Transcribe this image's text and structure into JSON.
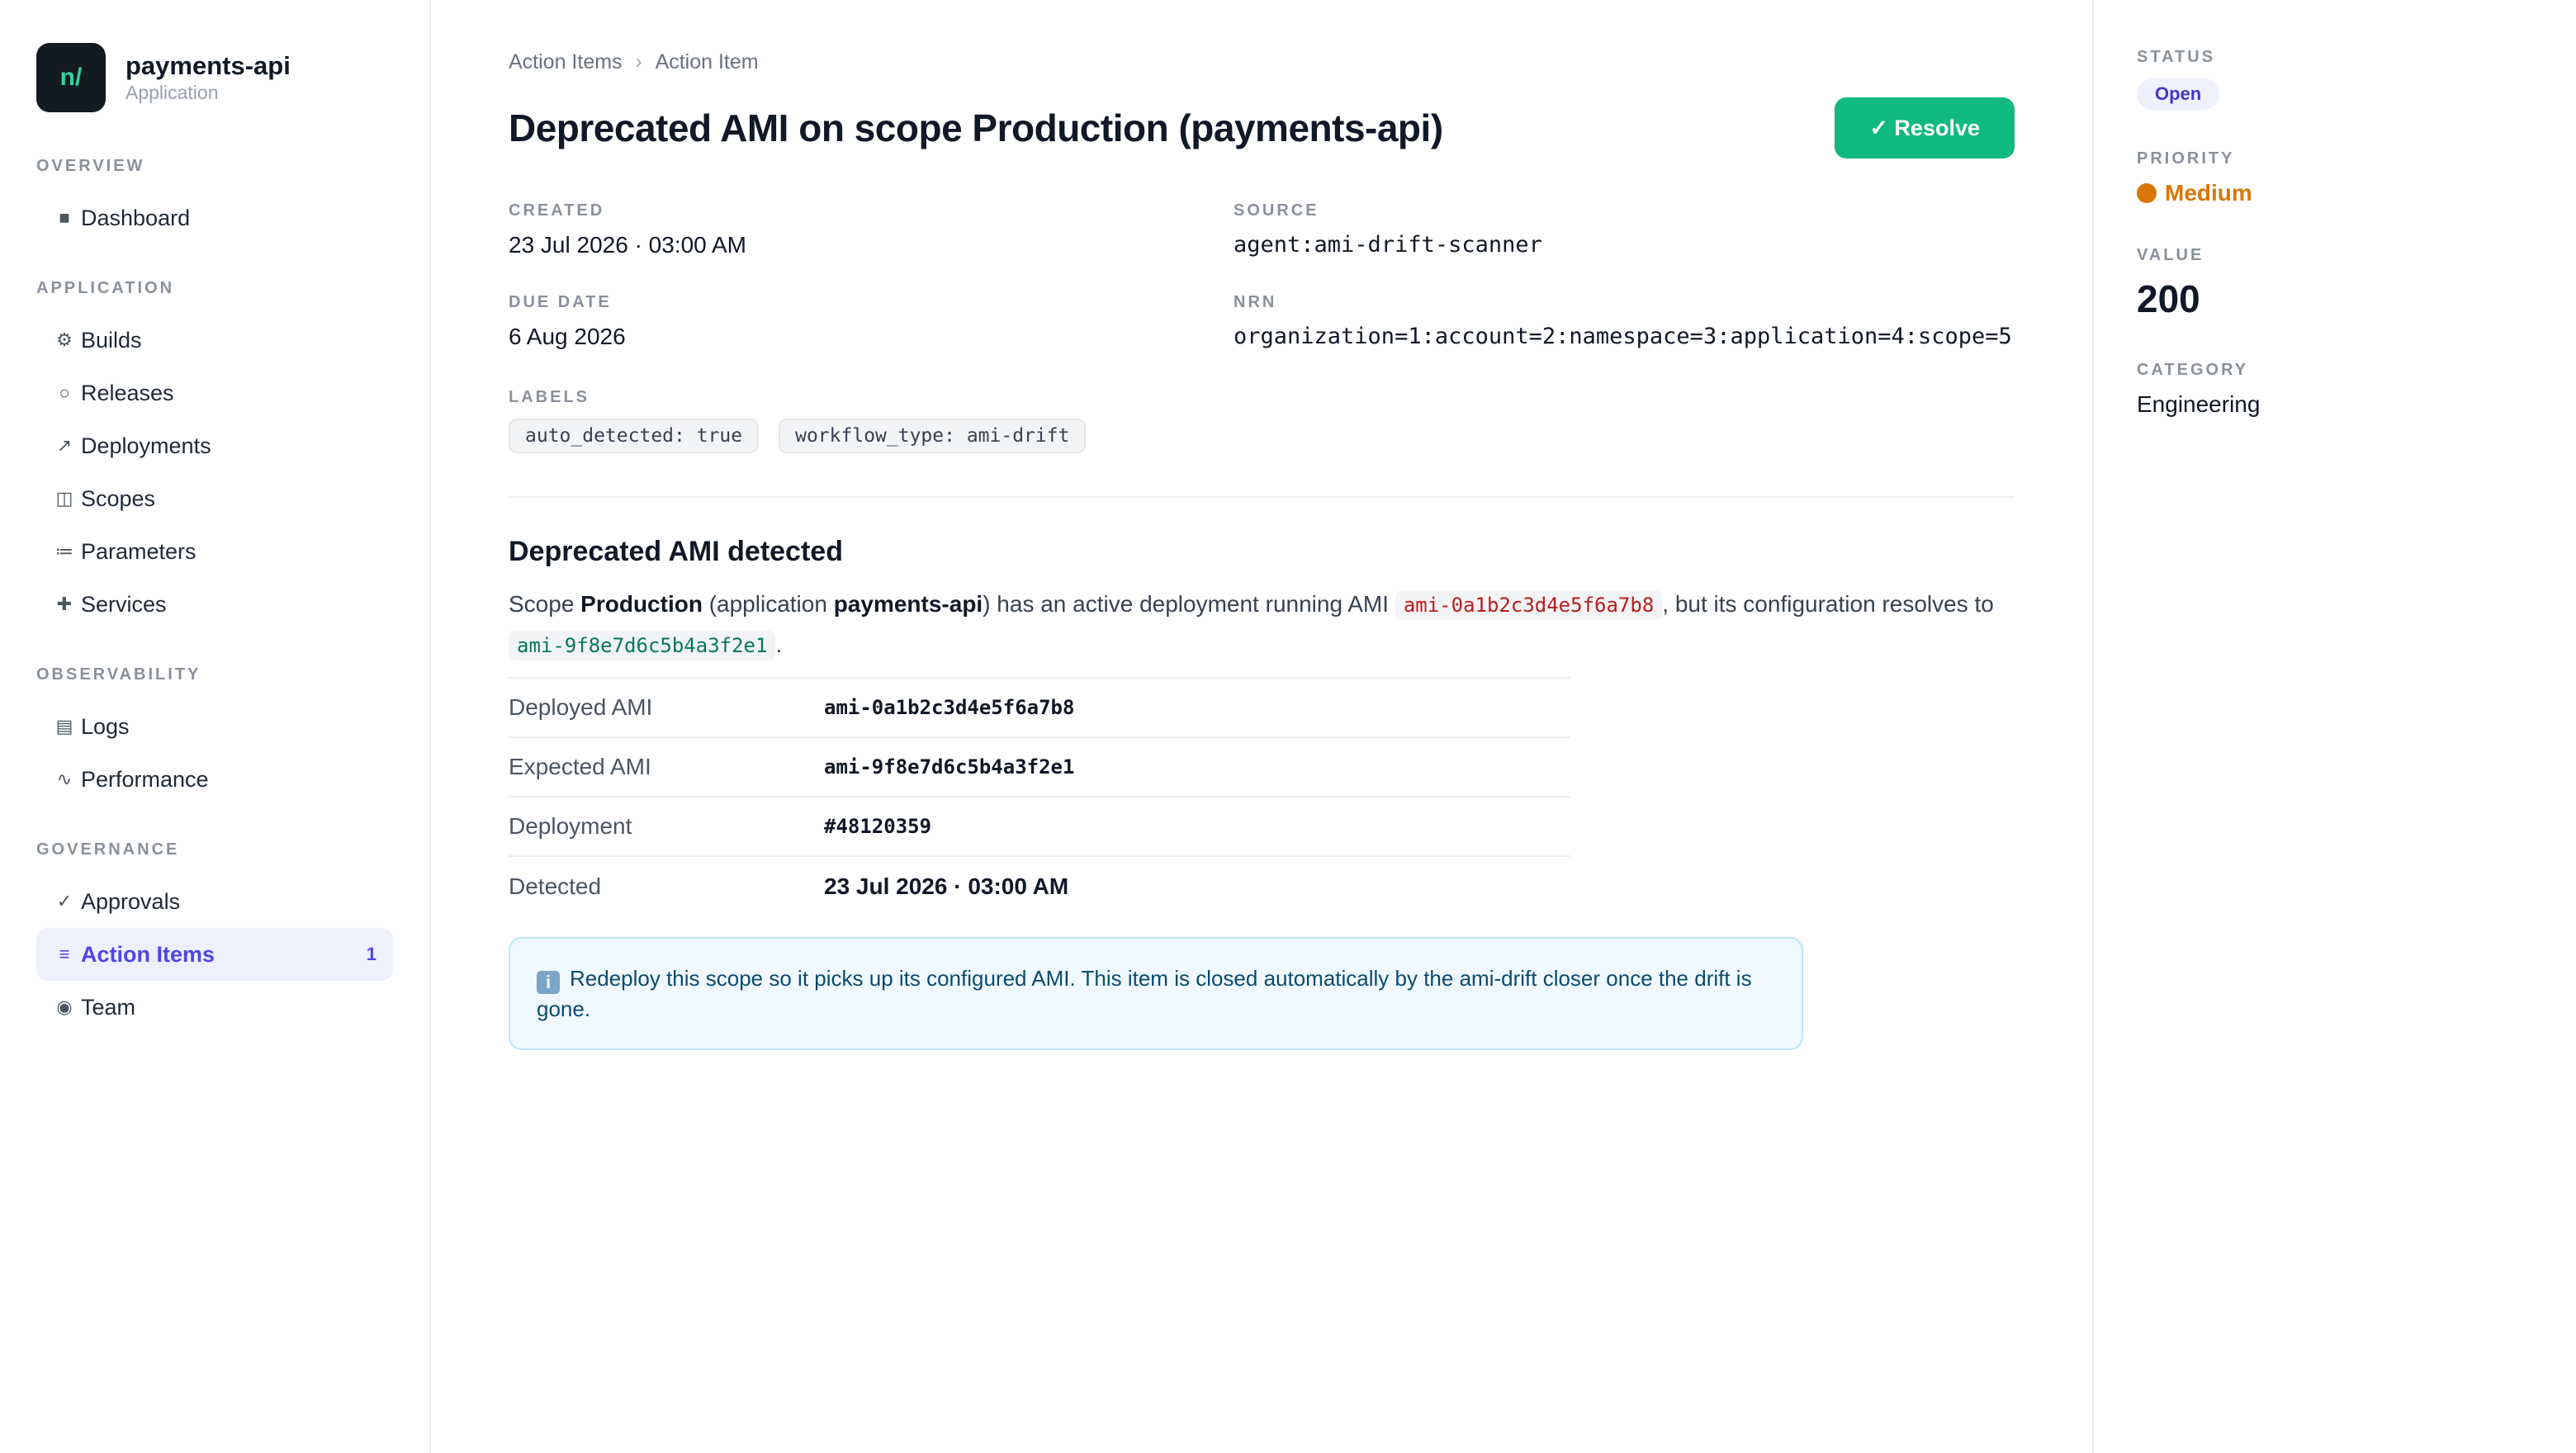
{
  "app": {
    "logo_text": "n/",
    "name": "payments-api",
    "subtitle": "Application"
  },
  "sidebar": {
    "sections": [
      {
        "title": "OVERVIEW",
        "items": [
          {
            "icon": "dashboard-icon",
            "glyph": "■",
            "label": "Dashboard"
          }
        ]
      },
      {
        "title": "APPLICATION",
        "items": [
          {
            "icon": "builds-icon",
            "glyph": "⚙",
            "label": "Builds"
          },
          {
            "icon": "releases-icon",
            "glyph": "○",
            "label": "Releases"
          },
          {
            "icon": "deployments-icon",
            "glyph": "↗",
            "label": "Deployments"
          },
          {
            "icon": "scopes-icon",
            "glyph": "◫",
            "label": "Scopes"
          },
          {
            "icon": "parameters-icon",
            "glyph": "≔",
            "label": "Parameters"
          },
          {
            "icon": "services-icon",
            "glyph": "✚",
            "label": "Services"
          }
        ]
      },
      {
        "title": "OBSERVABILITY",
        "items": [
          {
            "icon": "logs-icon",
            "glyph": "▤",
            "label": "Logs"
          },
          {
            "icon": "performance-icon",
            "glyph": "∿",
            "label": "Performance"
          }
        ]
      },
      {
        "title": "GOVERNANCE",
        "items": [
          {
            "icon": "approvals-icon",
            "glyph": "✓",
            "label": "Approvals"
          },
          {
            "icon": "action-items-icon",
            "glyph": "≡",
            "label": "Action Items",
            "badge": "1"
          },
          {
            "icon": "team-icon",
            "glyph": "◉",
            "label": "Team"
          }
        ]
      }
    ]
  },
  "breadcrumb": {
    "parent": "Action Items",
    "separator": "›",
    "current": "Action Item"
  },
  "page": {
    "title": "Deprecated AMI on scope Production (payments-api)",
    "resolve_label": "✓ Resolve"
  },
  "meta": {
    "created_label": "CREATED",
    "created": "23 Jul 2026 · 03:00 AM",
    "source_label": "SOURCE",
    "source": "agent:ami-drift-scanner",
    "due_label": "DUE DATE",
    "due": "6 Aug 2026",
    "nrn_label": "NRN",
    "nrn": "organization=1:account=2:namespace=3:application=4:scope=5",
    "labels_label": "LABELS",
    "labels": [
      "auto_detected: true",
      "workflow_type: ami-drift"
    ]
  },
  "detail": {
    "title": "Deprecated AMI detected",
    "desc": {
      "p1": "Scope ",
      "scope": "Production",
      "p2": " (application ",
      "app": "payments-api",
      "p3": ") has an active deployment running AMI ",
      "deployed_ami": "ami-0a1b2c3d4e5f6a7b8",
      "p4": ", but its configuration resolves to ",
      "expected_ami": "ami-9f8e7d6c5b4a3f2e1",
      "p5": "."
    },
    "rows": [
      {
        "key": "Deployed AMI",
        "value": "ami-0a1b2c3d4e5f6a7b8",
        "mono": true
      },
      {
        "key": "Expected AMI",
        "value": "ami-9f8e7d6c5b4a3f2e1",
        "mono": true
      },
      {
        "key": "Deployment",
        "value": "#48120359",
        "mono": true
      },
      {
        "key": "Detected",
        "value": "23 Jul 2026 · 03:00 AM",
        "mono": false
      }
    ],
    "info_icon": "i",
    "info": "Redeploy this scope so it picks up its configured AMI. This item is closed automatically by the ami-drift closer once the drift is gone."
  },
  "right_panel": {
    "status_label": "STATUS",
    "status": "Open",
    "priority_label": "PRIORITY",
    "priority": "Medium",
    "value_label": "VALUE",
    "value": "200",
    "category_label": "CATEGORY",
    "category": "Engineering"
  },
  "colors": {
    "accent": "#4f46e5",
    "resolve": "#10b981",
    "priority": "#d97706",
    "info_bg": "#f0f9ff"
  }
}
